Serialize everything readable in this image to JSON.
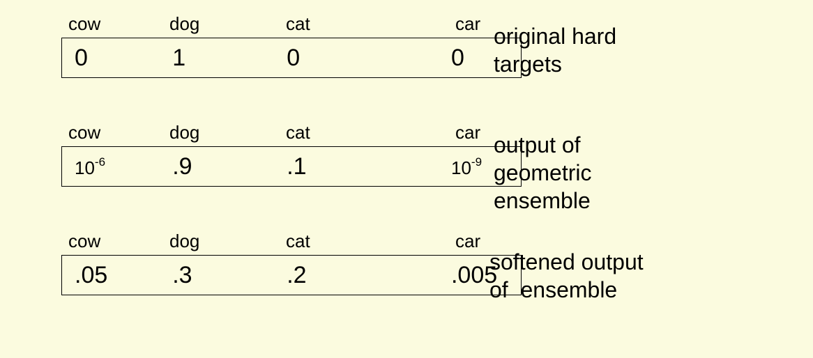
{
  "columns": [
    "cow",
    "dog",
    "cat",
    "car"
  ],
  "rows": [
    {
      "label": "original hard targets",
      "values_display": [
        "0",
        "1",
        "0",
        "0"
      ],
      "values_numeric": [
        0,
        1,
        0,
        0
      ]
    },
    {
      "label": "output of geometric ensemble",
      "values_display": [
        "10^-6",
        ".9",
        ".1",
        "10^-9"
      ],
      "values_numeric": [
        1e-06,
        0.9,
        0.1,
        1e-09
      ]
    },
    {
      "label": "softened output of ensemble",
      "values_display": [
        ".05",
        ".3",
        ".2",
        ".005"
      ],
      "values_numeric": [
        0.05,
        0.3,
        0.2,
        0.005
      ]
    }
  ]
}
